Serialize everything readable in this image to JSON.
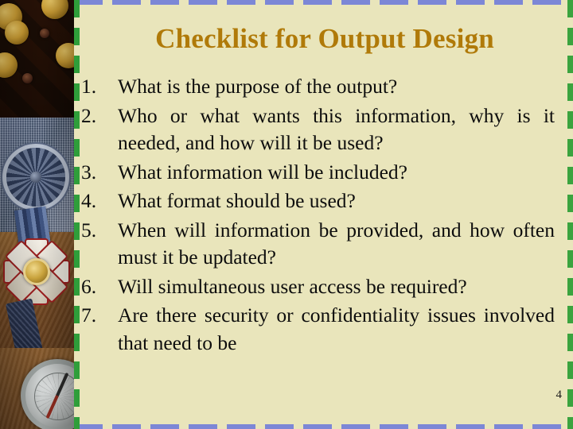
{
  "slide": {
    "title": "Checklist for Output Design",
    "page_number": "4",
    "background_color": "#e9e5bb",
    "title_color": "#b07a09",
    "body_text_color": "#0d0d0d",
    "border_top_color": "#7c87d6",
    "border_bottom_color": "#7c87d6",
    "border_left_color": "#2f9e3a",
    "border_right_color": "#3ba33f"
  },
  "checklist": [
    {
      "number": "1.",
      "text": "What is the purpose of the output?",
      "single_line": true
    },
    {
      "number": "2.",
      "text": "Who or what wants this information, why is it needed, and how will it be used?",
      "single_line": false
    },
    {
      "number": "3.",
      "text": "What information will be included?",
      "single_line": true
    },
    {
      "number": "4.",
      "text": "What format should be used?",
      "single_line": true
    },
    {
      "number": "5.",
      "text": "When will information be provided, and how often must it be updated?",
      "single_line": false
    },
    {
      "number": "6.",
      "text": "Will simultaneous user access be required?",
      "single_line": false
    },
    {
      "number": "7.",
      "text": "Are there security or confidentiality issues involved that need to be",
      "single_line": false
    }
  ],
  "decoration": {
    "left_strip": "photographic-collage-coins-medal-compass"
  }
}
